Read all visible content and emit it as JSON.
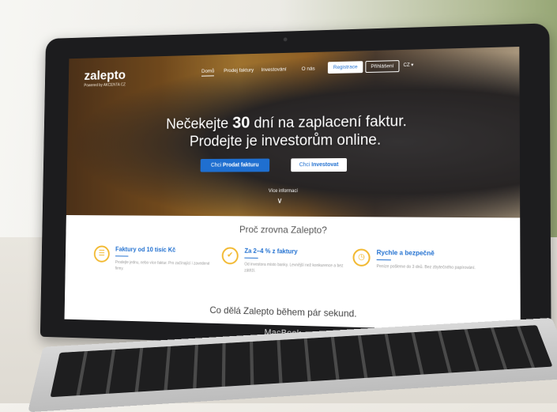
{
  "site": {
    "logo": "zalepto",
    "logo_sub": "Powered by AKCENTA CZ",
    "nav": [
      "Domů",
      "Prodej faktury",
      "Investování",
      "O nás"
    ],
    "register": "Registrace",
    "login": "Přihlášení",
    "lang": "CZ ▾"
  },
  "hero": {
    "line1_a": "Nečekejte ",
    "line1_b": "30",
    "line1_c": " dní na zaplacení faktur.",
    "line2": "Prodejte je investorům online.",
    "cta_sell_prefix": "Chci ",
    "cta_sell_bold": "Prodat fakturu",
    "cta_invest_prefix": "Chci ",
    "cta_invest_bold": "Investovat",
    "more_info": "Více informací"
  },
  "section": {
    "why": "Proč zrovna Zalepto?",
    "features": [
      {
        "title": "Faktury od 10 tisíc Kč",
        "desc": "Prodejte jednu, nebo více faktur. Pro začínající i zavedené firmy.",
        "icon": "speech-bubble-icon"
      },
      {
        "title": "Za 2–4 % z faktury",
        "desc": "Od investora místo banky. Levnější než konkurence a bez zátěží.",
        "icon": "thumbs-up-icon"
      },
      {
        "title": "Rychle a bezpečně",
        "desc": "Peníze pošleme do 3 dnů. Bez zbytečného papírování.",
        "icon": "stopwatch-icon"
      }
    ],
    "what": "Co dělá Zalepto během pár sekund."
  },
  "device": {
    "brand": "MacBook"
  },
  "colors": {
    "accent": "#1f6fd0",
    "highlight": "#f2b82e"
  }
}
